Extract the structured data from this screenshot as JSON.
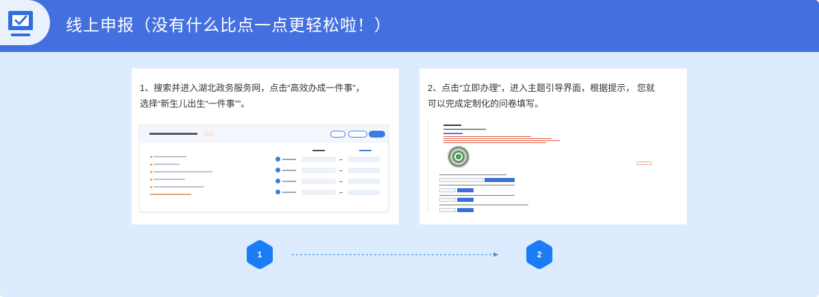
{
  "header": {
    "title": "线上申报（没有什么比点一点更轻松啦！）",
    "icon": "checked-screen-icon"
  },
  "steps": [
    {
      "number": "1",
      "lines": [
        "1、搜索并进入湖北政务服务网，点击“高效办成一件事”，",
        "选择“新生儿出生“一件事””。"
      ],
      "screenshot": "search-result-screenshot"
    },
    {
      "number": "2",
      "lines": [
        "2、点击“立即办理”，进入主题引导界面，根据提示， 您就",
        "可以完成定制化的问卷填写。"
      ],
      "screenshot": "questionnaire-screenshot"
    }
  ],
  "colors": {
    "header_bg": "#4470df",
    "panel_bg": "#dcebfd",
    "step_badge": "#1a7cf7",
    "connector": "#4a90e2"
  }
}
